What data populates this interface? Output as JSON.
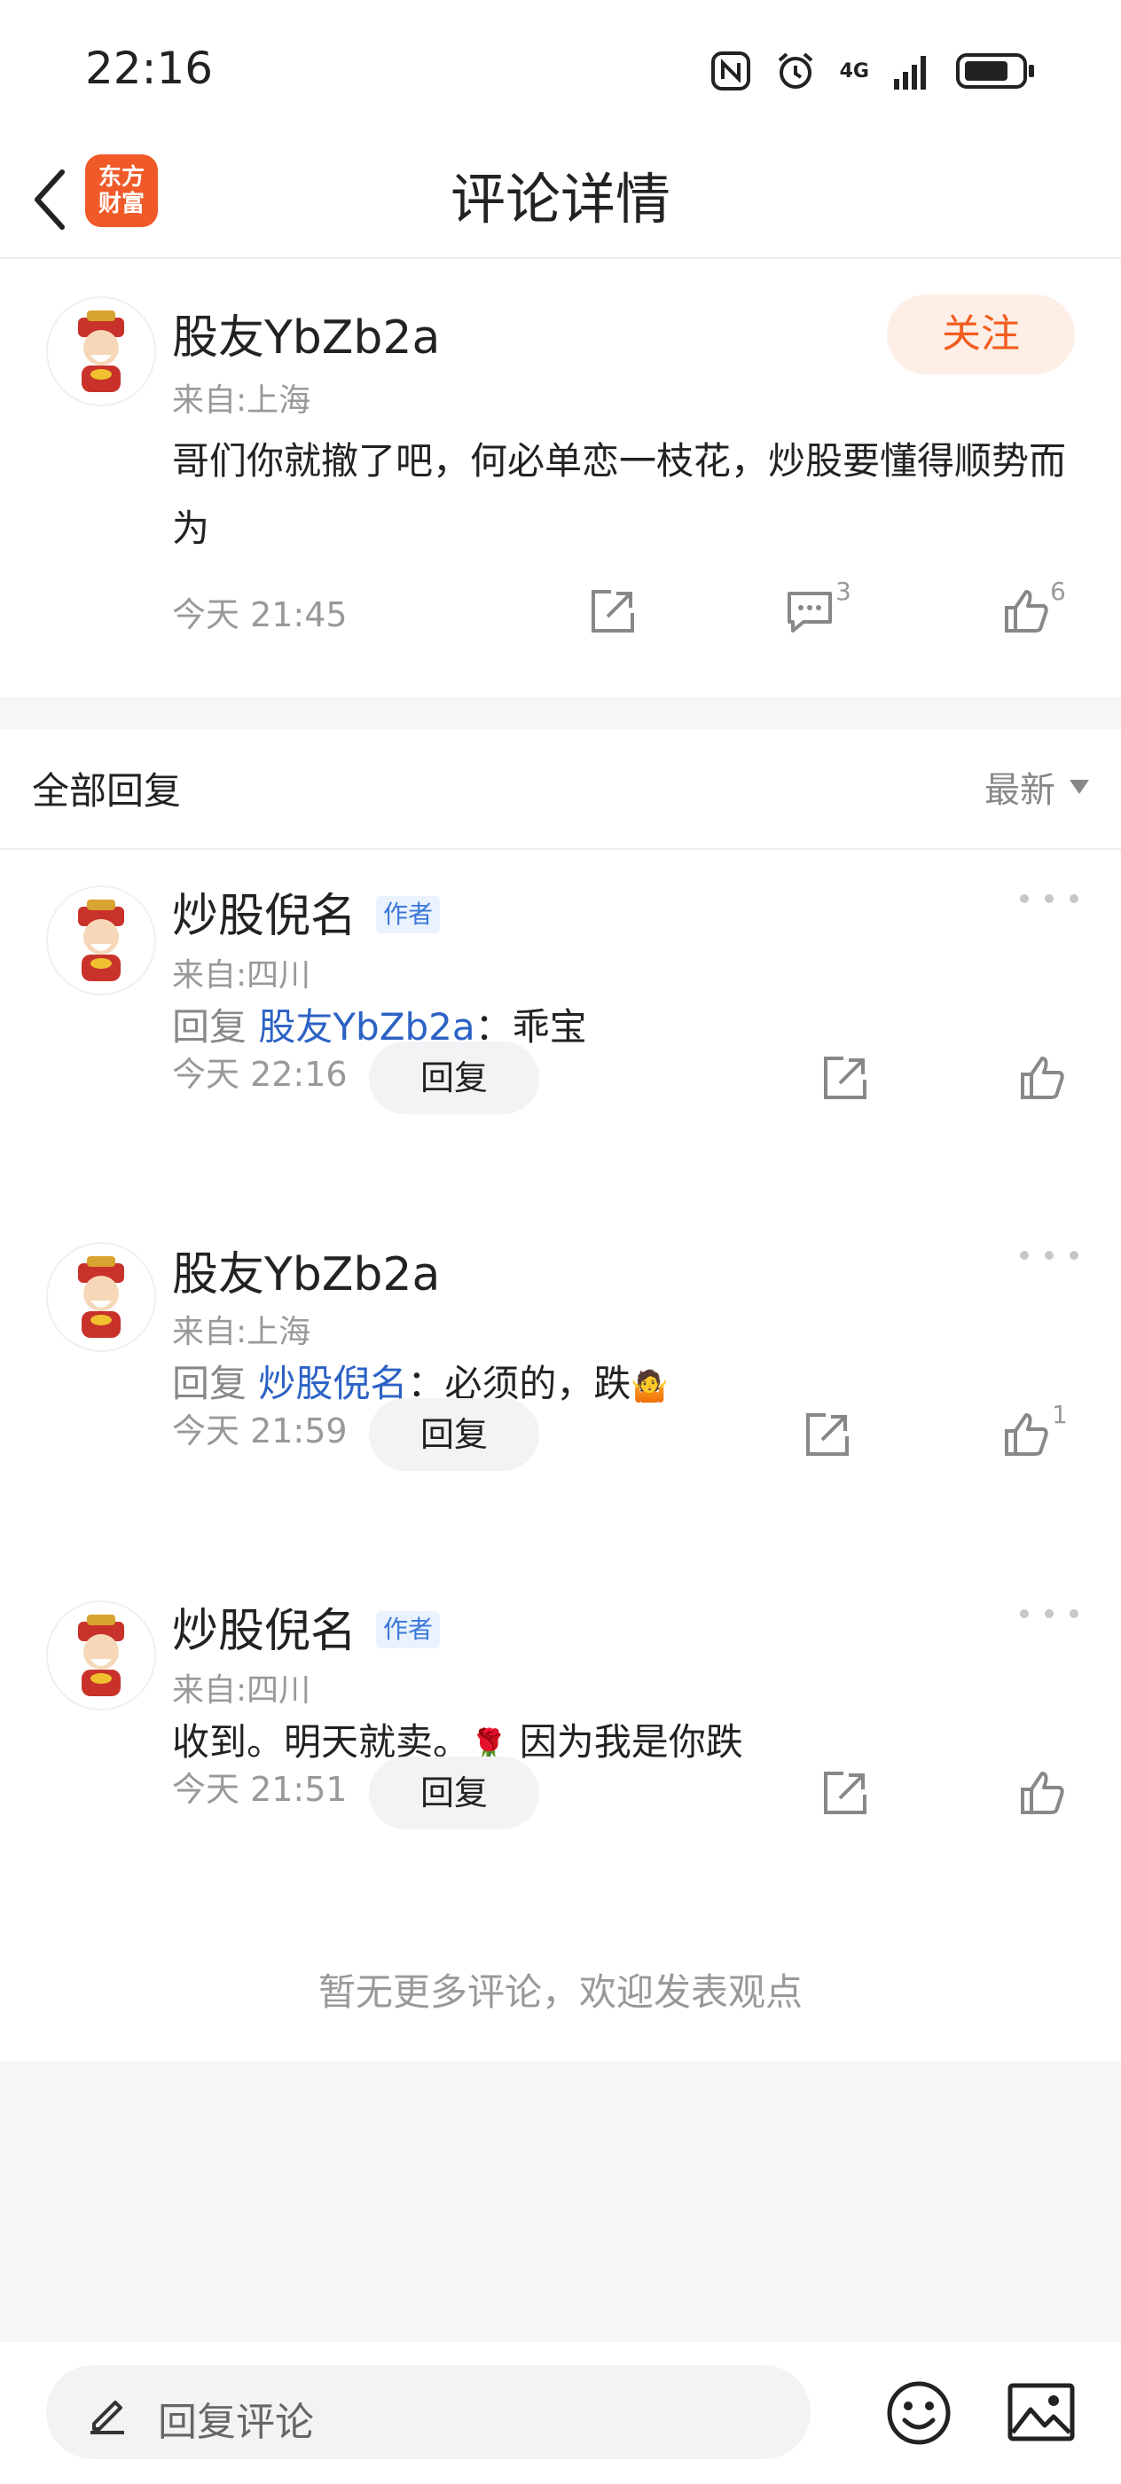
{
  "status_bar": {
    "time": "22:16",
    "network": "4G"
  },
  "nav": {
    "title": "评论详情",
    "logo_line1": "东方",
    "logo_line2": "财富"
  },
  "main_comment": {
    "username": "股友YbZb2a",
    "location": "来自:上海",
    "follow_label": "关注",
    "content": "哥们你就撤了吧，何必单恋一枝花，炒股要懂得顺势而为",
    "time": "今天 21:45",
    "reply_count": "3",
    "like_count": "6"
  },
  "replies_section": {
    "title": "全部回复",
    "sort_label": "最新",
    "end_text": "暂无更多评论，欢迎发表观点"
  },
  "replies": [
    {
      "username": "炒股倪名",
      "badge": "作者",
      "location": "来自:四川",
      "prefix": "回复",
      "target": "股友YbZb2a",
      "text": "：乖宝",
      "time": "今天 22:16",
      "reply_label": "回复",
      "like_count": ""
    },
    {
      "username": "股友YbZb2a",
      "badge": "",
      "location": "来自:上海",
      "prefix": "回复",
      "target": "炒股倪名",
      "text": "：必须的，跌",
      "emoji": "🤷",
      "time": "今天 21:59",
      "reply_label": "回复",
      "like_count": "1"
    },
    {
      "username": "炒股倪名",
      "badge": "作者",
      "location": "来自:四川",
      "text_before": "收到。明天就卖。",
      "emoji": "🌹",
      "text_after": " 因为我是你跌",
      "time": "今天 21:51",
      "reply_label": "回复",
      "like_count": ""
    }
  ],
  "bottom_bar": {
    "input_placeholder": "回复评论"
  },
  "colors": {
    "accent": "#f25d1f",
    "link": "#2c62c5",
    "muted": "#999999"
  }
}
